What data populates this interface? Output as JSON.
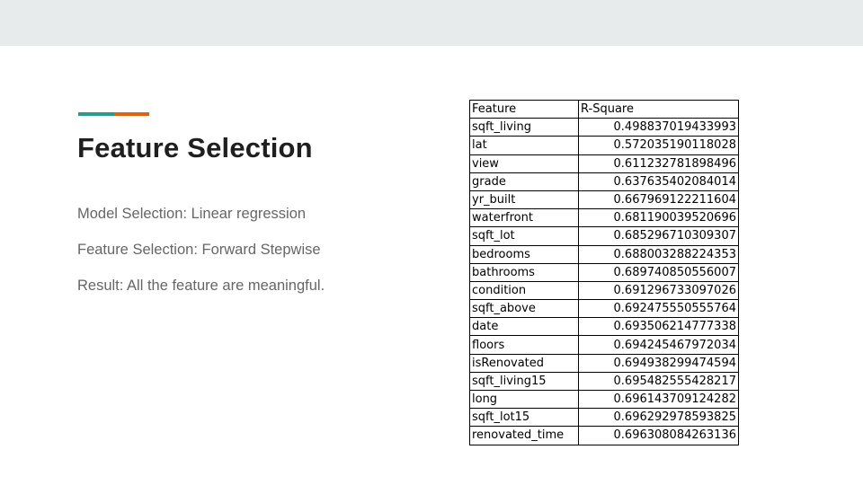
{
  "slide": {
    "title": "Feature Selection",
    "lines": [
      "Model Selection: Linear regression",
      "Feature Selection: Forward Stepwise",
      "Result: All the feature are meaningful."
    ]
  },
  "colors": {
    "top_band": "#e8ebec",
    "accent_teal": "#2a9a8b",
    "accent_orange": "#e0620f",
    "title": "#1f1f1f",
    "body_text": "#666666"
  },
  "table": {
    "headers": [
      "Feature",
      "R-Square"
    ],
    "rows": [
      [
        "sqft_living",
        "0.498837019433993"
      ],
      [
        "lat",
        "0.572035190118028"
      ],
      [
        "view",
        "0.611232781898496"
      ],
      [
        "grade",
        "0.637635402084014"
      ],
      [
        "yr_built",
        "0.667969122211604"
      ],
      [
        "waterfront",
        "0.681190039520696"
      ],
      [
        "sqft_lot",
        "0.685296710309307"
      ],
      [
        "bedrooms",
        "0.688003288224353"
      ],
      [
        "bathrooms",
        "0.689740850556007"
      ],
      [
        "condition",
        "0.691296733097026"
      ],
      [
        "sqft_above",
        "0.692475550555764"
      ],
      [
        "date",
        "0.693506214777338"
      ],
      [
        "floors",
        "0.694245467972034"
      ],
      [
        "isRenovated",
        "0.694938299474594"
      ],
      [
        "sqft_living15",
        "0.695482555428217"
      ],
      [
        "long",
        "0.696143709124282"
      ],
      [
        "sqft_lot15",
        "0.696292978593825"
      ],
      [
        "renovated_time",
        "0.696308084263136"
      ]
    ]
  }
}
